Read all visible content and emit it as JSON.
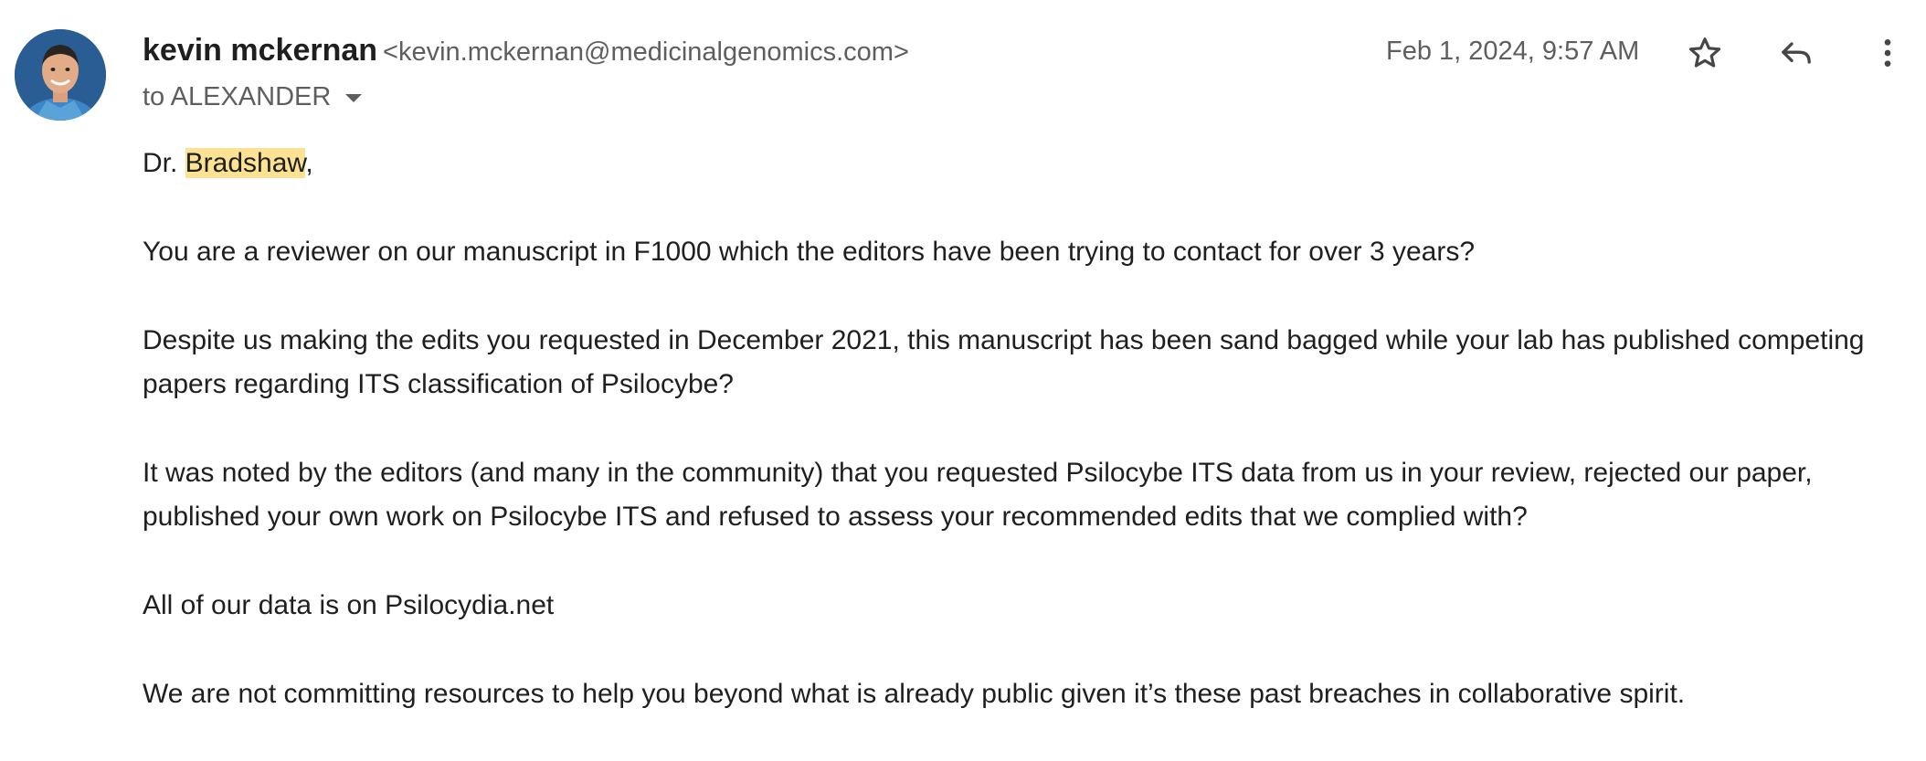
{
  "sender": {
    "name": "kevin mckernan",
    "email": "<kevin.mckernan@medicinalgenomics.com>",
    "avatar": "avatar-photo"
  },
  "recipient": {
    "label": "to ALEXANDER"
  },
  "timestamp": "Feb 1, 2024, 9:57 AM",
  "actions": {
    "star": "star-icon",
    "reply": "reply-icon",
    "more": "more-vertical-icon"
  },
  "body": {
    "greeting_prefix": "Dr. ",
    "greeting_name": "Bradshaw",
    "greeting_suffix": ",",
    "paragraphs": [
      "You are a reviewer on our manuscript in F1000 which the editors have been trying to contact for over 3 years?",
      "Despite us making the edits you requested in December 2021, this manuscript has been sand bagged while your lab has published competing papers regarding ITS classification of Psilocybe?",
      "It was noted by the editors (and many in the community) that you requested Psilocybe ITS data from us in your review, rejected our paper, published your own work on Psilocybe ITS and refused to assess your recommended edits that we complied with?",
      "All of our data is on Psilocydia.net",
      "We are not committing resources to help you beyond what is already public given it’s these past breaches in collaborative spirit."
    ]
  },
  "colors": {
    "highlight": "#fde293",
    "text": "#1f1f1f",
    "secondary_text": "#5e5e5e",
    "icon": "#444746"
  }
}
